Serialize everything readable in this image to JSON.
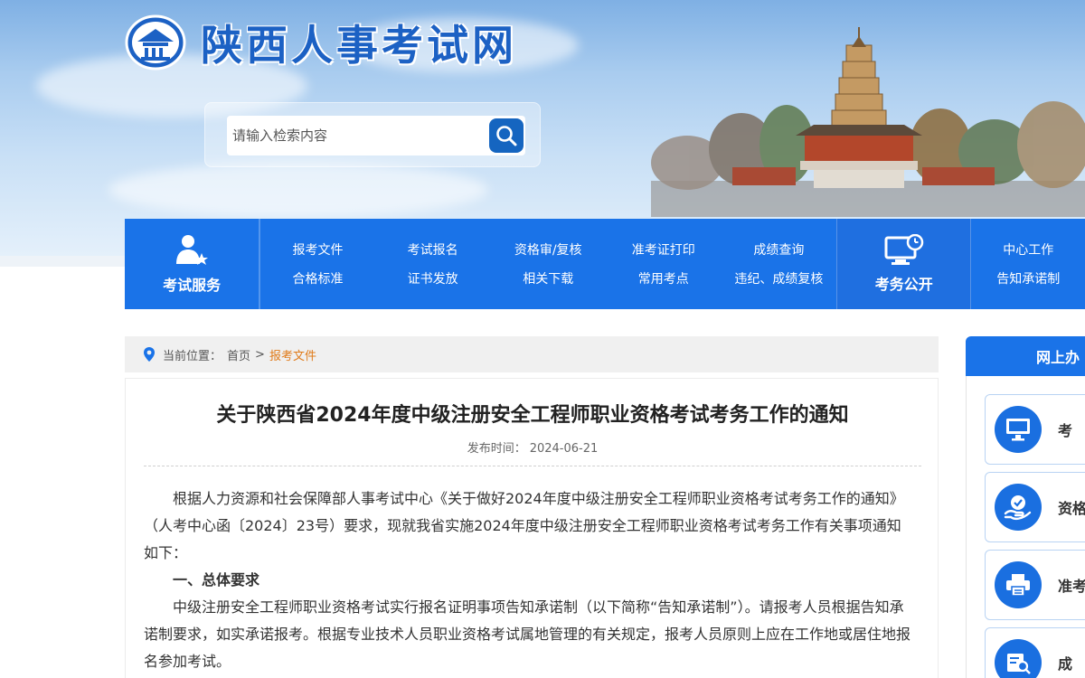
{
  "site": {
    "logo_text": "陕西人事考试网",
    "search_placeholder": "请输入检索内容"
  },
  "nav": {
    "exam_service_label": "考试服务",
    "columns": [
      {
        "top": "报考文件",
        "bottom": "合格标准"
      },
      {
        "top": "考试报名",
        "bottom": "证书发放"
      },
      {
        "top": "资格审/复核",
        "bottom": "相关下载"
      },
      {
        "top": "准考证打印",
        "bottom": "常用考点"
      },
      {
        "top": "成绩查询",
        "bottom": "违纪、成绩复核"
      }
    ],
    "exam_affairs_label": "考务公开",
    "right_column": {
      "top": "中心工作",
      "bottom": "告知承诺制"
    }
  },
  "breadcrumb": {
    "prefix": "当前位置：",
    "home": "首页",
    "separator": ">",
    "current": "报考文件"
  },
  "article": {
    "title": "关于陕西省2024年度中级注册安全工程师职业资格考试考务工作的通知",
    "publish_label": "发布时间：",
    "publish_date": "2024-06-21",
    "para1": "根据人力资源和社会保障部人事考试中心《关于做好2024年度中级注册安全工程师职业资格考试考务工作的通知》（人考中心函〔2024〕23号）要求，现就我省实施2024年度中级注册安全工程师职业资格考试考务工作有关事项通知如下：",
    "section1": "一、总体要求",
    "para2": "中级注册安全工程师职业资格考试实行报名证明事项告知承诺制（以下简称“告知承诺制”）。请报考人员根据告知承诺制要求，如实承诺报考。根据专业技术人员职业资格考试属地管理的有关规定，报考人员原则上应在工作地或居住地报名参加考试。"
  },
  "sidebar": {
    "header": "网上办",
    "cards": [
      {
        "label": "考",
        "icon": "monitor-icon"
      },
      {
        "label": "资格",
        "icon": "hand-check-icon"
      },
      {
        "label": "准考",
        "icon": "printer-icon"
      },
      {
        "label": "成",
        "icon": "search-list-icon"
      }
    ]
  },
  "colors": {
    "nav_blue": "#1a73e8",
    "logo_blue": "#1c61c4",
    "breadcrumb_current": "#e07b1a"
  }
}
